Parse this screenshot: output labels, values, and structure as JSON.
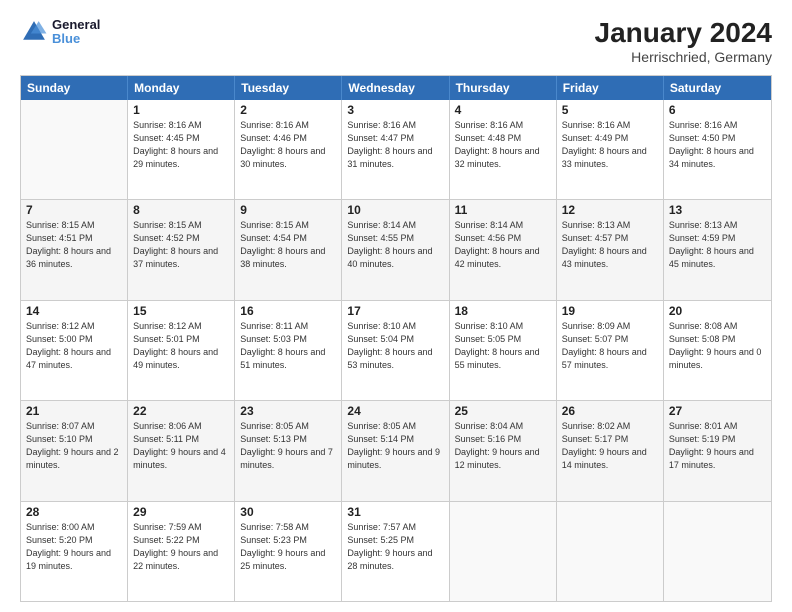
{
  "header": {
    "logo_line1": "General",
    "logo_line2": "Blue",
    "title": "January 2024",
    "subtitle": "Herrischried, Germany"
  },
  "calendar": {
    "days_of_week": [
      "Sunday",
      "Monday",
      "Tuesday",
      "Wednesday",
      "Thursday",
      "Friday",
      "Saturday"
    ],
    "weeks": [
      [
        {
          "day": "",
          "sunrise": "",
          "sunset": "",
          "daylight": ""
        },
        {
          "day": "1",
          "sunrise": "Sunrise: 8:16 AM",
          "sunset": "Sunset: 4:45 PM",
          "daylight": "Daylight: 8 hours and 29 minutes."
        },
        {
          "day": "2",
          "sunrise": "Sunrise: 8:16 AM",
          "sunset": "Sunset: 4:46 PM",
          "daylight": "Daylight: 8 hours and 30 minutes."
        },
        {
          "day": "3",
          "sunrise": "Sunrise: 8:16 AM",
          "sunset": "Sunset: 4:47 PM",
          "daylight": "Daylight: 8 hours and 31 minutes."
        },
        {
          "day": "4",
          "sunrise": "Sunrise: 8:16 AM",
          "sunset": "Sunset: 4:48 PM",
          "daylight": "Daylight: 8 hours and 32 minutes."
        },
        {
          "day": "5",
          "sunrise": "Sunrise: 8:16 AM",
          "sunset": "Sunset: 4:49 PM",
          "daylight": "Daylight: 8 hours and 33 minutes."
        },
        {
          "day": "6",
          "sunrise": "Sunrise: 8:16 AM",
          "sunset": "Sunset: 4:50 PM",
          "daylight": "Daylight: 8 hours and 34 minutes."
        }
      ],
      [
        {
          "day": "7",
          "sunrise": "Sunrise: 8:15 AM",
          "sunset": "Sunset: 4:51 PM",
          "daylight": "Daylight: 8 hours and 36 minutes."
        },
        {
          "day": "8",
          "sunrise": "Sunrise: 8:15 AM",
          "sunset": "Sunset: 4:52 PM",
          "daylight": "Daylight: 8 hours and 37 minutes."
        },
        {
          "day": "9",
          "sunrise": "Sunrise: 8:15 AM",
          "sunset": "Sunset: 4:54 PM",
          "daylight": "Daylight: 8 hours and 38 minutes."
        },
        {
          "day": "10",
          "sunrise": "Sunrise: 8:14 AM",
          "sunset": "Sunset: 4:55 PM",
          "daylight": "Daylight: 8 hours and 40 minutes."
        },
        {
          "day": "11",
          "sunrise": "Sunrise: 8:14 AM",
          "sunset": "Sunset: 4:56 PM",
          "daylight": "Daylight: 8 hours and 42 minutes."
        },
        {
          "day": "12",
          "sunrise": "Sunrise: 8:13 AM",
          "sunset": "Sunset: 4:57 PM",
          "daylight": "Daylight: 8 hours and 43 minutes."
        },
        {
          "day": "13",
          "sunrise": "Sunrise: 8:13 AM",
          "sunset": "Sunset: 4:59 PM",
          "daylight": "Daylight: 8 hours and 45 minutes."
        }
      ],
      [
        {
          "day": "14",
          "sunrise": "Sunrise: 8:12 AM",
          "sunset": "Sunset: 5:00 PM",
          "daylight": "Daylight: 8 hours and 47 minutes."
        },
        {
          "day": "15",
          "sunrise": "Sunrise: 8:12 AM",
          "sunset": "Sunset: 5:01 PM",
          "daylight": "Daylight: 8 hours and 49 minutes."
        },
        {
          "day": "16",
          "sunrise": "Sunrise: 8:11 AM",
          "sunset": "Sunset: 5:03 PM",
          "daylight": "Daylight: 8 hours and 51 minutes."
        },
        {
          "day": "17",
          "sunrise": "Sunrise: 8:10 AM",
          "sunset": "Sunset: 5:04 PM",
          "daylight": "Daylight: 8 hours and 53 minutes."
        },
        {
          "day": "18",
          "sunrise": "Sunrise: 8:10 AM",
          "sunset": "Sunset: 5:05 PM",
          "daylight": "Daylight: 8 hours and 55 minutes."
        },
        {
          "day": "19",
          "sunrise": "Sunrise: 8:09 AM",
          "sunset": "Sunset: 5:07 PM",
          "daylight": "Daylight: 8 hours and 57 minutes."
        },
        {
          "day": "20",
          "sunrise": "Sunrise: 8:08 AM",
          "sunset": "Sunset: 5:08 PM",
          "daylight": "Daylight: 9 hours and 0 minutes."
        }
      ],
      [
        {
          "day": "21",
          "sunrise": "Sunrise: 8:07 AM",
          "sunset": "Sunset: 5:10 PM",
          "daylight": "Daylight: 9 hours and 2 minutes."
        },
        {
          "day": "22",
          "sunrise": "Sunrise: 8:06 AM",
          "sunset": "Sunset: 5:11 PM",
          "daylight": "Daylight: 9 hours and 4 minutes."
        },
        {
          "day": "23",
          "sunrise": "Sunrise: 8:05 AM",
          "sunset": "Sunset: 5:13 PM",
          "daylight": "Daylight: 9 hours and 7 minutes."
        },
        {
          "day": "24",
          "sunrise": "Sunrise: 8:05 AM",
          "sunset": "Sunset: 5:14 PM",
          "daylight": "Daylight: 9 hours and 9 minutes."
        },
        {
          "day": "25",
          "sunrise": "Sunrise: 8:04 AM",
          "sunset": "Sunset: 5:16 PM",
          "daylight": "Daylight: 9 hours and 12 minutes."
        },
        {
          "day": "26",
          "sunrise": "Sunrise: 8:02 AM",
          "sunset": "Sunset: 5:17 PM",
          "daylight": "Daylight: 9 hours and 14 minutes."
        },
        {
          "day": "27",
          "sunrise": "Sunrise: 8:01 AM",
          "sunset": "Sunset: 5:19 PM",
          "daylight": "Daylight: 9 hours and 17 minutes."
        }
      ],
      [
        {
          "day": "28",
          "sunrise": "Sunrise: 8:00 AM",
          "sunset": "Sunset: 5:20 PM",
          "daylight": "Daylight: 9 hours and 19 minutes."
        },
        {
          "day": "29",
          "sunrise": "Sunrise: 7:59 AM",
          "sunset": "Sunset: 5:22 PM",
          "daylight": "Daylight: 9 hours and 22 minutes."
        },
        {
          "day": "30",
          "sunrise": "Sunrise: 7:58 AM",
          "sunset": "Sunset: 5:23 PM",
          "daylight": "Daylight: 9 hours and 25 minutes."
        },
        {
          "day": "31",
          "sunrise": "Sunrise: 7:57 AM",
          "sunset": "Sunset: 5:25 PM",
          "daylight": "Daylight: 9 hours and 28 minutes."
        },
        {
          "day": "",
          "sunrise": "",
          "sunset": "",
          "daylight": ""
        },
        {
          "day": "",
          "sunrise": "",
          "sunset": "",
          "daylight": ""
        },
        {
          "day": "",
          "sunrise": "",
          "sunset": "",
          "daylight": ""
        }
      ]
    ]
  }
}
